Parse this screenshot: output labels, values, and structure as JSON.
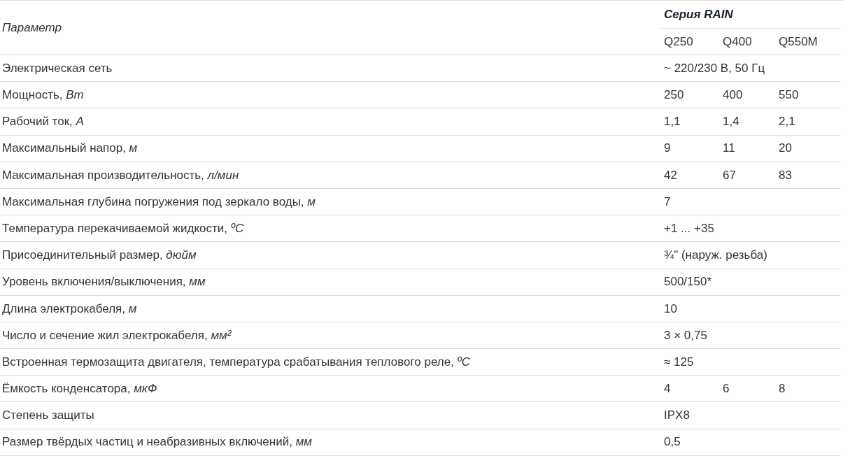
{
  "table": {
    "parameter_header": "Параметр",
    "series_header": "Серия RAIN",
    "models": [
      "Q250",
      "Q400",
      "Q550M"
    ],
    "rows": [
      {
        "parameter": "Электрическая сеть",
        "values": [
          "~ 220/230 В, 50 Гц"
        ]
      },
      {
        "parameter": "Мощность, *Вт*",
        "values": [
          "250",
          "400",
          "550"
        ]
      },
      {
        "parameter": "Рабочий ток, *А*",
        "values": [
          "1,1",
          "1,4",
          "2,1"
        ]
      },
      {
        "parameter": "Максимальный напор, *м*",
        "values": [
          "9",
          "11",
          "20"
        ]
      },
      {
        "parameter": "Максимальная производительность, *л/мин*",
        "values": [
          "42",
          "67",
          "83"
        ]
      },
      {
        "parameter": "Максимальная глубина погружения под зеркало воды, *м*",
        "values": [
          "7"
        ]
      },
      {
        "parameter": "Температура перекачиваемой жидкости, *ºС*",
        "values": [
          "+1 ... +35"
        ]
      },
      {
        "parameter": "Присоединительный размер, *дюйм*",
        "values": [
          "¾\" (наруж. резьба)"
        ]
      },
      {
        "parameter": "Уровень включения/выключения, *мм*",
        "values": [
          "500/150*"
        ]
      },
      {
        "parameter": "Длина электрокабеля, *м*",
        "values": [
          "10"
        ]
      },
      {
        "parameter": "Число и сечение жил электрокабеля, *мм²*",
        "values": [
          "3 × 0,75"
        ]
      },
      {
        "parameter": "Встроенная термозащита двигателя, температура срабатывания теплового реле, *ºС*",
        "values": [
          "≈ 125"
        ]
      },
      {
        "parameter": "Ёмкость конденсатора, *мкФ*",
        "values": [
          "4",
          "6",
          "8"
        ]
      },
      {
        "parameter": "Степень защиты",
        "values": [
          "IPX8"
        ]
      },
      {
        "parameter": "Размер твёрдых частиц и неабразивных включений, *мм*",
        "values": [
          "0,5"
        ]
      }
    ]
  }
}
